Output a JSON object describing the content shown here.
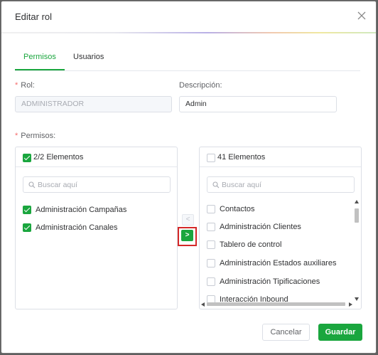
{
  "dialog": {
    "title": "Editar rol"
  },
  "tabs": [
    {
      "label": "Permisos",
      "active": true
    },
    {
      "label": "Usuarios",
      "active": false
    }
  ],
  "form": {
    "required_mark": "*",
    "rol": {
      "label": "Rol",
      "colon": ":",
      "value": "ADMINISTRADOR",
      "disabled": true
    },
    "descripcion": {
      "label": "Descripción",
      "colon": ":",
      "value": "Admin"
    },
    "permisos": {
      "label": "Permisos",
      "colon": ":"
    }
  },
  "transfer": {
    "left": {
      "header": "2/2 Elementos",
      "all_checked": true,
      "search_placeholder": "Buscar aquí",
      "items": [
        {
          "label": "Administración Campañas",
          "checked": true
        },
        {
          "label": "Administración Canales",
          "checked": true
        }
      ]
    },
    "right": {
      "header": "41 Elementos",
      "all_checked": false,
      "search_placeholder": "Buscar aquí",
      "items": [
        {
          "label": "Contactos",
          "checked": false
        },
        {
          "label": "Administración Clientes",
          "checked": false
        },
        {
          "label": "Tablero de control",
          "checked": false
        },
        {
          "label": "Administración Estados auxiliares",
          "checked": false
        },
        {
          "label": "Administración Tipificaciones",
          "checked": false
        },
        {
          "label": "Interacción Inbound",
          "checked": false
        }
      ]
    },
    "buttons": {
      "to_left": "<",
      "to_right": ">"
    }
  },
  "footer": {
    "cancel_label": "Cancelar",
    "save_label": "Guardar"
  },
  "colors": {
    "accent": "#1aa63e",
    "highlight": "#d42828",
    "required": "#f56c6c"
  }
}
